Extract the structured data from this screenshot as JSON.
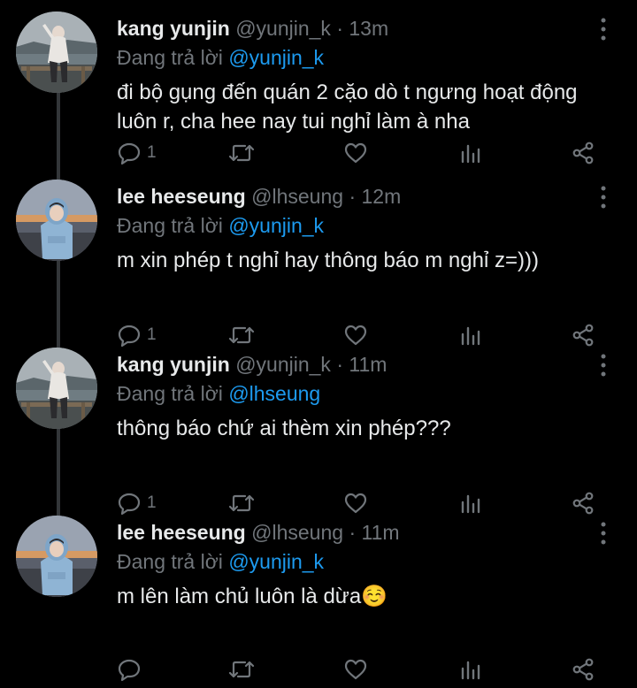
{
  "colors": {
    "background": "#000000",
    "text": "#e7e9ea",
    "muted": "#71767b",
    "accent": "#1d9bf0",
    "thread_line": "#333639"
  },
  "tweets": [
    {
      "name": "kang yunjin",
      "handle": "@yunjin_k",
      "separator": "·",
      "time": "13m",
      "replying_prefix": "Đang trả lời",
      "replying_to": "@yunjin_k",
      "text": "đi bộ gụng đến quán 2 cặo dò t ngưng hoạt động luôn r, cha hee nay tui nghỉ làm à nha",
      "reply_count": "1",
      "avatar": "yunjin-seaside-photo",
      "icons": [
        "reply-icon",
        "retweet-icon",
        "like-icon",
        "analytics-icon",
        "share-icon"
      ]
    },
    {
      "name": "lee heeseung",
      "handle": "@lhseung",
      "separator": "·",
      "time": "12m",
      "replying_prefix": "Đang trả lời",
      "replying_to": "@yunjin_k",
      "text": "m xin phép t nghỉ hay thông báo m nghỉ z=)))",
      "reply_count": "1",
      "avatar": "heeseung-hoodie-photo",
      "icons": [
        "reply-icon",
        "retweet-icon",
        "like-icon",
        "analytics-icon",
        "share-icon"
      ]
    },
    {
      "name": "kang yunjin",
      "handle": "@yunjin_k",
      "separator": "·",
      "time": "11m",
      "replying_prefix": "Đang trả lời",
      "replying_to": "@lhseung",
      "text": "thông báo chứ ai thèm xin phép???",
      "reply_count": "1",
      "avatar": "yunjin-seaside-photo",
      "icons": [
        "reply-icon",
        "retweet-icon",
        "like-icon",
        "analytics-icon",
        "share-icon"
      ]
    },
    {
      "name": "lee heeseung",
      "handle": "@lhseung",
      "separator": "·",
      "time": "11m",
      "replying_prefix": "Đang trả lời",
      "replying_to": "@yunjin_k",
      "text": "m lên làm chủ luôn là dừa☺️",
      "reply_count": "",
      "avatar": "heeseung-hoodie-photo",
      "icons": [
        "reply-icon",
        "retweet-icon",
        "like-icon",
        "analytics-icon",
        "share-icon"
      ]
    }
  ]
}
